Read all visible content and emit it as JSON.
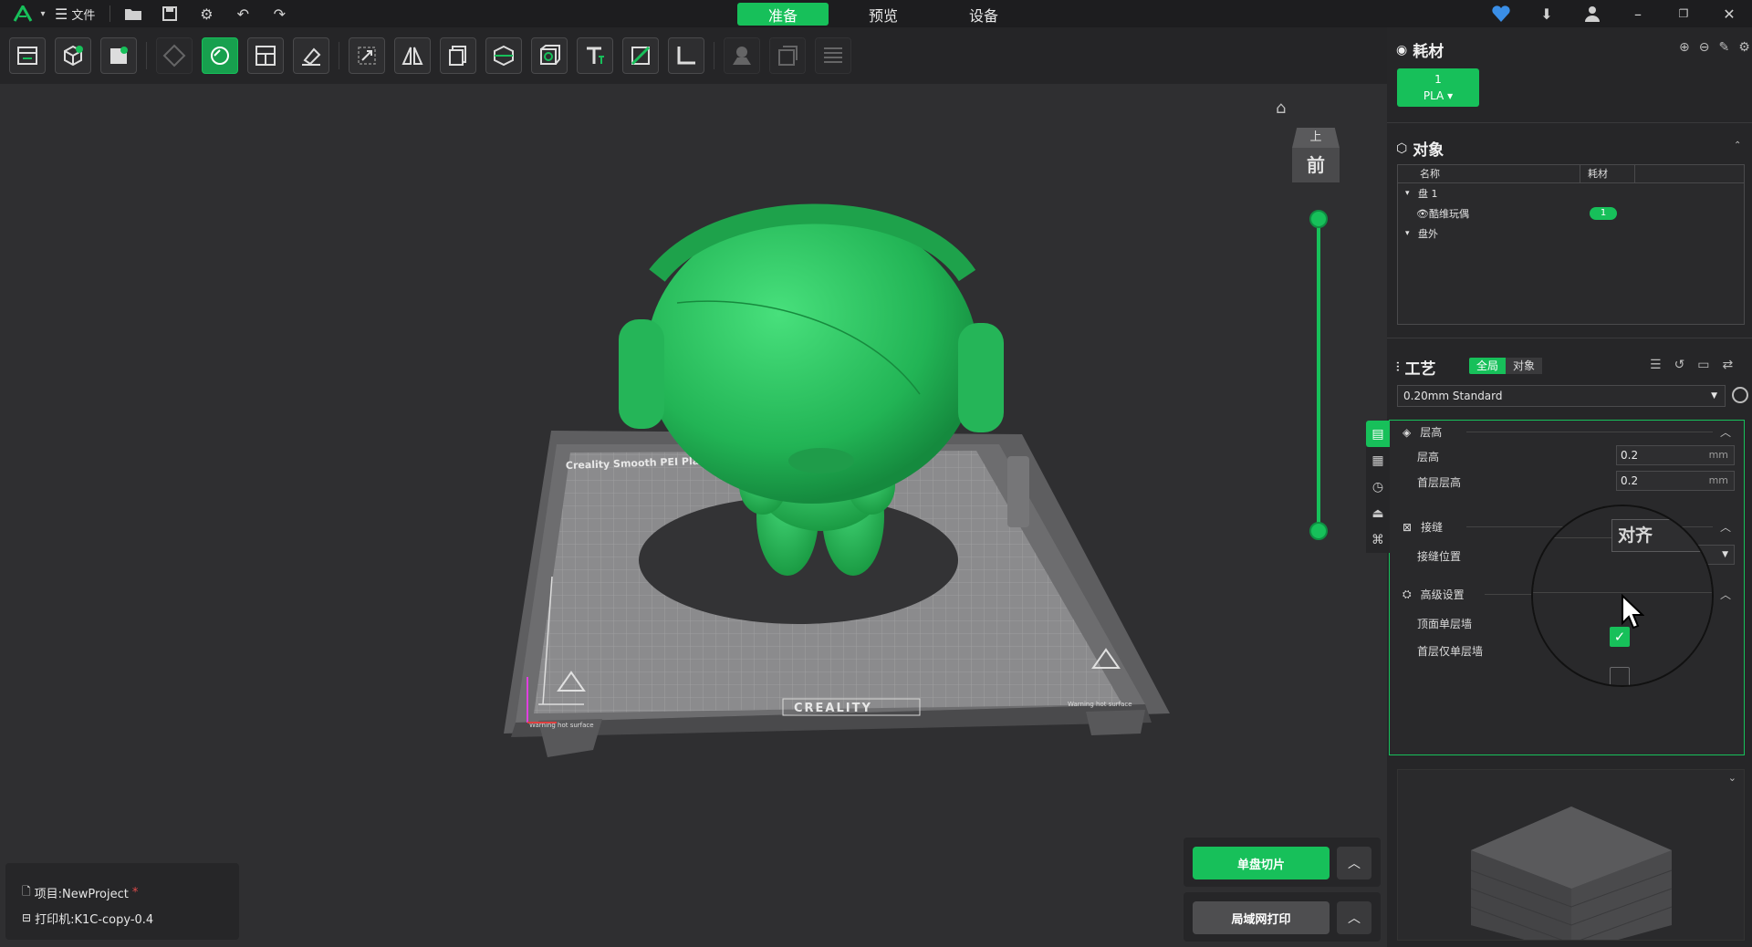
{
  "titlebar": {
    "file_label": "文件",
    "tabs": [
      {
        "label": "准备",
        "active": true
      },
      {
        "label": "预览",
        "active": false
      },
      {
        "label": "设备",
        "active": false
      }
    ]
  },
  "accent_color": "#17c05a",
  "viewport": {
    "view_cube_top": "上",
    "view_cube_front": "前",
    "plate_brand": "CREALITY",
    "plate_name": "Creality Smooth PEI Plate",
    "warning_text": "Warning hot surface"
  },
  "project": {
    "project_label": "项目:NewProject",
    "modified_mark": "*",
    "printer_label": "打印机:K1C-copy-0.4"
  },
  "actions": {
    "slice_label": "单盘切片",
    "lan_print_label": "局域网打印"
  },
  "filament": {
    "title": "耗材",
    "chip_index": "1",
    "chip_type": "PLA"
  },
  "objects": {
    "title": "对象",
    "col_name": "名称",
    "col_filament": "耗材",
    "rows": [
      {
        "label": "盘 1"
      },
      {
        "label": "酷维玩偶",
        "filament": "1"
      },
      {
        "label": "盘外"
      }
    ]
  },
  "process": {
    "title": "工艺",
    "tab_global": "全局",
    "tab_object": "对象",
    "preset": "0.20mm Standard",
    "groups": {
      "layer_height": {
        "title": "层高",
        "layer_height_label": "层高",
        "layer_height_value": "0.2",
        "first_layer_label": "首层层高",
        "first_layer_value": "0.2",
        "unit": "mm"
      },
      "seam": {
        "title": "接缝",
        "position_label": "接缝位置",
        "position_value": "对齐"
      },
      "advanced": {
        "title": "高级设置",
        "top_single_wall_label": "顶面单层墙",
        "top_single_wall_checked": true,
        "first_layer_single_wall_label": "首层仅单层墙",
        "first_layer_single_wall_checked": false
      }
    }
  }
}
